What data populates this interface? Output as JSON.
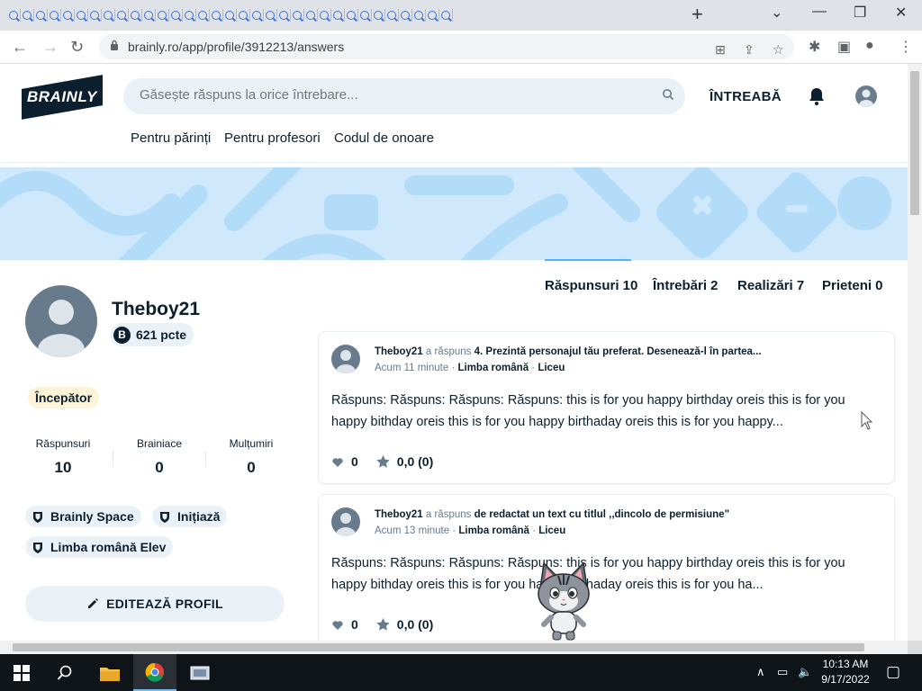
{
  "browser": {
    "url": "brainly.ro/app/profile/3912213/answers",
    "new_tab_label": "+",
    "tab_count": 33
  },
  "header": {
    "logo_text": "BRAINLY",
    "search_placeholder": "Găsește răspuns la orice întrebare...",
    "ask_label": "ÎNTREABĂ",
    "subnav": [
      "Pentru părinți",
      "Pentru profesori",
      "Codul de onoare"
    ]
  },
  "profile": {
    "name": "Theboy21",
    "points": "621 pcte",
    "points_badge": "B",
    "rank": "Începător",
    "stats": [
      {
        "label": "Răspunsuri",
        "value": "10"
      },
      {
        "label": "Brainiace",
        "value": "0"
      },
      {
        "label": "Mulțumiri",
        "value": "0"
      }
    ],
    "badges": [
      "Brainly Space",
      "Inițiază",
      "Limba română Elev"
    ],
    "edit_label": "EDITEAZĂ PROFIL"
  },
  "tabs": [
    {
      "label": "Răspunsuri 10",
      "active": true
    },
    {
      "label": "Întrebări 2",
      "active": false
    },
    {
      "label": "Realizări 7",
      "active": false
    },
    {
      "label": "Prieteni 0",
      "active": false
    }
  ],
  "answers": [
    {
      "user": "Theboy21",
      "verb": "a răspuns",
      "question": "4. Prezintă personajul tău preferat. Desenează-l în partea...",
      "time": "Acum 11 minute",
      "subject": "Limba română",
      "level": "Liceu",
      "text": "Răspuns: Răspuns: Răspuns: Răspuns: this is for you happy birthday oreis this is for you happy bithday oreis this is for you happy birthaday oreis this is for you happy...",
      "likes": "0",
      "rating": "0,0 (0)"
    },
    {
      "user": "Theboy21",
      "verb": "a răspuns",
      "question": "de redactat un text cu titlul ,,dincolo de permisiune\"",
      "time": "Acum 13 minute",
      "subject": "Limba română",
      "level": "Liceu",
      "text": "Răspuns: Răspuns: Răspuns: Răspuns: this is for you happy birthday oreis this is for you happy bithday oreis this is for you happy birthaday oreis this is for you ha...",
      "likes": "0",
      "rating": "0,0 (0)"
    }
  ],
  "taskbar": {
    "time": "10:13 AM",
    "date": "9/17/2022"
  },
  "colors": {
    "brand_dark": "#0c1f2e",
    "banner": "#cfe8fb",
    "tab_underline": "#4fb3f6",
    "chip_bg": "#ebf2f7",
    "rank_bg": "#fef4d7"
  }
}
